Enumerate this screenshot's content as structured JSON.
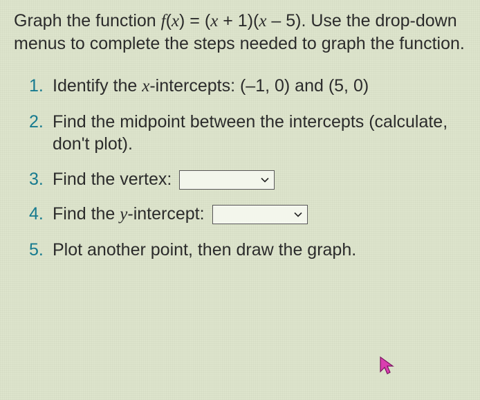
{
  "prompt": {
    "pre": "Graph the function ",
    "fn_lhs_f": "f",
    "fn_lhs_x": "x",
    "eq": " = (",
    "x1": "x",
    "mid1": " + 1)(",
    "x2": "x",
    "mid2": " – 5). ",
    "rest": "Use the drop-down menus to complete the steps needed to graph the function."
  },
  "steps": {
    "s1_a": "Identify the ",
    "s1_var": "x",
    "s1_b": "-intercepts: (–1, 0) and (5, 0)",
    "s2": "Find the midpoint between the intercepts (calculate, don't plot).",
    "s3_label": "Find the vertex: ",
    "s4_a": "Find the ",
    "s4_var": "y",
    "s4_b": "-intercept: ",
    "s5": "Plot another point, then draw the graph."
  },
  "dropdowns": {
    "vertex_value": "",
    "yint_value": ""
  },
  "icons": {
    "chevron": "chevron-down-icon",
    "cursor": "cursor-icon"
  }
}
